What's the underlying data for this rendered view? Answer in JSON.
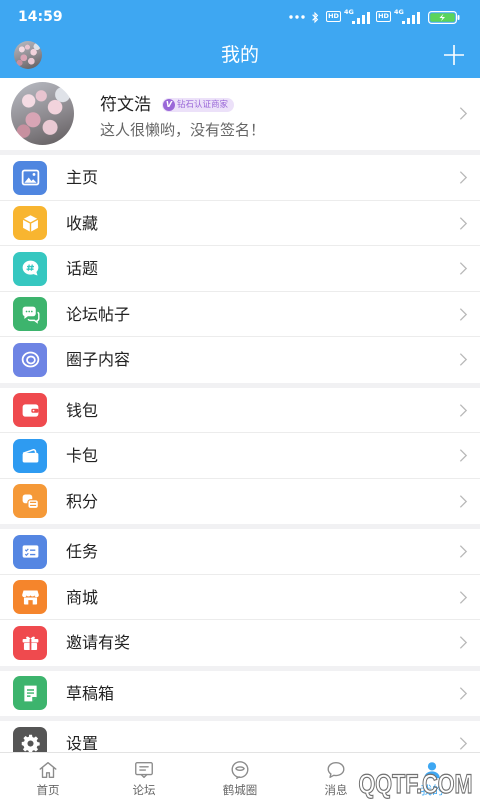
{
  "status_bar": {
    "time": "14:59",
    "sim1": {
      "hd": "HD",
      "network": "4G"
    },
    "sim2": {
      "hd": "HD",
      "network": "4G"
    },
    "battery_charging": true
  },
  "header": {
    "title": "我的",
    "left_icon": "avatar",
    "right_icon": "plus-icon"
  },
  "profile": {
    "name": "符文浩",
    "badge_icon": "V",
    "badge": "钻石认证商家",
    "signature": "这人很懒哟，没有签名！"
  },
  "menu_groups": [
    {
      "items": [
        {
          "label": "主页",
          "icon": "image-icon",
          "color": "#4F86E0"
        },
        {
          "label": "收藏",
          "icon": "box-icon",
          "color": "#F8B530"
        },
        {
          "label": "话题",
          "icon": "topic-icon",
          "color": "#36C7C0"
        },
        {
          "label": "论坛帖子",
          "icon": "forum-icon",
          "color": "#3DB46D"
        },
        {
          "label": "圈子内容",
          "icon": "circle-icon",
          "color": "#6E84E4"
        }
      ]
    },
    {
      "items": [
        {
          "label": "钱包",
          "icon": "wallet-icon",
          "color": "#EF4A4E"
        },
        {
          "label": "卡包",
          "icon": "card-icon",
          "color": "#2E9BF1"
        },
        {
          "label": "积分",
          "icon": "coins-icon",
          "color": "#F59938"
        }
      ]
    },
    {
      "items": [
        {
          "label": "任务",
          "icon": "task-icon",
          "color": "#5586E2"
        },
        {
          "label": "商城",
          "icon": "store-icon",
          "color": "#F5852C"
        },
        {
          "label": "邀请有奖",
          "icon": "gift-icon",
          "color": "#EF4A4E"
        }
      ]
    },
    {
      "items": [
        {
          "label": "草稿箱",
          "icon": "draft-icon",
          "color": "#3DB46D"
        }
      ]
    },
    {
      "items": [
        {
          "label": "设置",
          "icon": "gear-icon",
          "color": "#555555"
        }
      ]
    }
  ],
  "bottom_nav": {
    "tabs": [
      {
        "label": "首页",
        "icon": "home-icon",
        "active": false
      },
      {
        "label": "论坛",
        "icon": "forum-board-icon",
        "active": false
      },
      {
        "label": "鹤城圈",
        "icon": "circle-chat-icon",
        "active": false
      },
      {
        "label": "消息",
        "icon": "message-icon",
        "active": false
      },
      {
        "label": "我的",
        "icon": "user-icon",
        "active": true
      }
    ]
  },
  "watermark": "QQTF.COM",
  "colors": {
    "brand_blue": "#3EA7F2",
    "badge_purple": "#9A68D8",
    "battery_green": "#5BD45B"
  }
}
